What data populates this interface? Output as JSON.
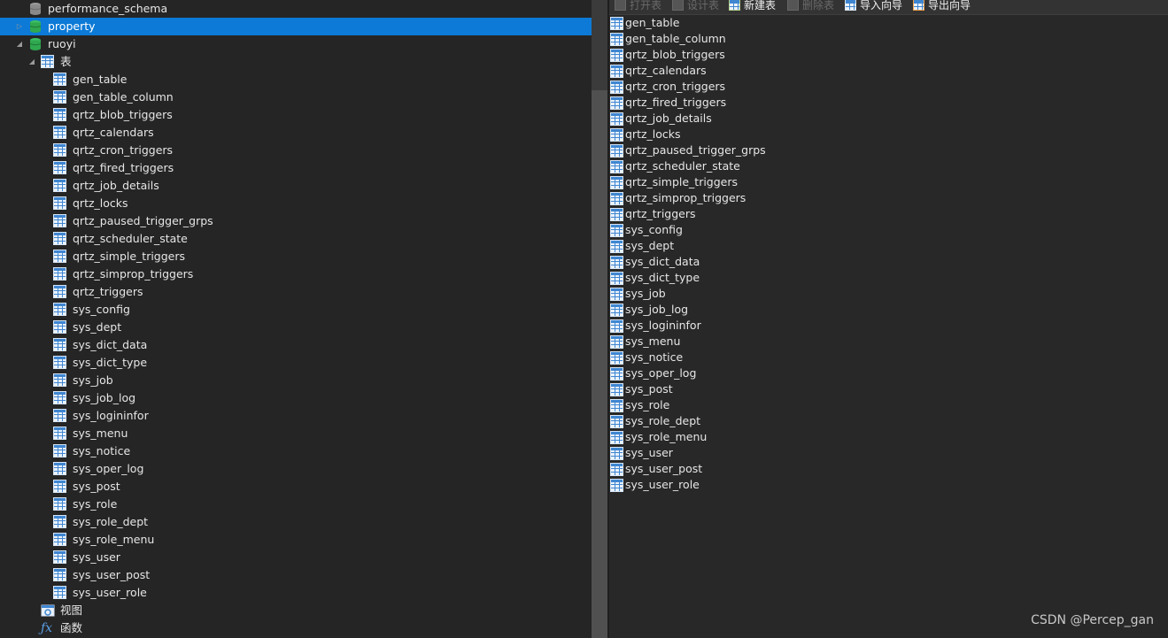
{
  "tree": {
    "databases": [
      {
        "name": "performance_schema"
      },
      {
        "name": "property",
        "selected": true
      },
      {
        "name": "ruoyi"
      }
    ],
    "tables_folder": "表",
    "views_folder": "视图",
    "functions_folder": "函数",
    "tables": [
      "gen_table",
      "gen_table_column",
      "qrtz_blob_triggers",
      "qrtz_calendars",
      "qrtz_cron_triggers",
      "qrtz_fired_triggers",
      "qrtz_job_details",
      "qrtz_locks",
      "qrtz_paused_trigger_grps",
      "qrtz_scheduler_state",
      "qrtz_simple_triggers",
      "qrtz_simprop_triggers",
      "qrtz_triggers",
      "sys_config",
      "sys_dept",
      "sys_dict_data",
      "sys_dict_type",
      "sys_job",
      "sys_job_log",
      "sys_logininfor",
      "sys_menu",
      "sys_notice",
      "sys_oper_log",
      "sys_post",
      "sys_role",
      "sys_role_dept",
      "sys_role_menu",
      "sys_user",
      "sys_user_post",
      "sys_user_role"
    ]
  },
  "toolbar": {
    "open_table": "打开表",
    "design_table": "设计表",
    "new_table": "新建表",
    "delete_table": "删除表",
    "import_wizard": "导入向导",
    "export_wizard": "导出向导"
  },
  "object_list": [
    "gen_table",
    "gen_table_column",
    "qrtz_blob_triggers",
    "qrtz_calendars",
    "qrtz_cron_triggers",
    "qrtz_fired_triggers",
    "qrtz_job_details",
    "qrtz_locks",
    "qrtz_paused_trigger_grps",
    "qrtz_scheduler_state",
    "qrtz_simple_triggers",
    "qrtz_simprop_triggers",
    "qrtz_triggers",
    "sys_config",
    "sys_dept",
    "sys_dict_data",
    "sys_dict_type",
    "sys_job",
    "sys_job_log",
    "sys_logininfor",
    "sys_menu",
    "sys_notice",
    "sys_oper_log",
    "sys_post",
    "sys_role",
    "sys_role_dept",
    "sys_role_menu",
    "sys_user",
    "sys_user_post",
    "sys_user_role"
  ],
  "watermark": "CSDN @Percep_gan",
  "colors": {
    "selection": "#0c7ad6",
    "db_green": "#2fa84f",
    "db_gray": "#9a9a9a",
    "table_blue": "#3f86d1"
  }
}
